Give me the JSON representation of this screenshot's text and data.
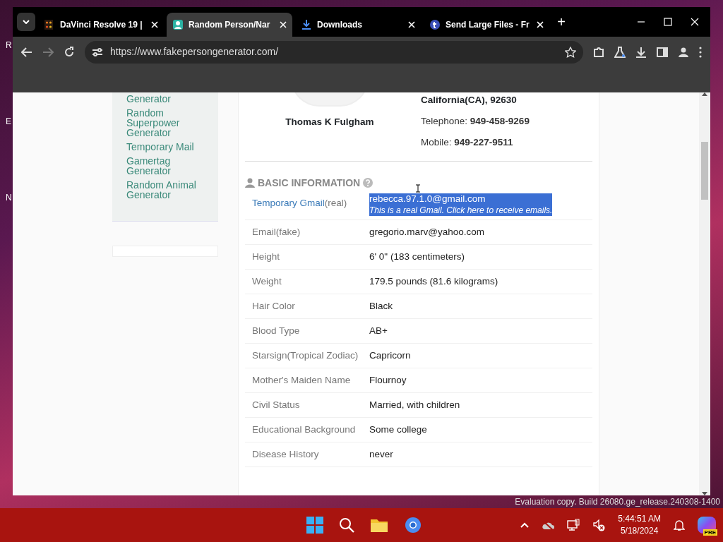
{
  "desktop": {
    "icon_labels": [
      "R",
      "E",
      "N"
    ],
    "watermark": "Evaluation copy. Build 26080.ge_release.240308-1400"
  },
  "browser": {
    "tabs": [
      {
        "title": "DaVinci Resolve 19 |",
        "selected": false
      },
      {
        "title": "Random Person/Nar",
        "selected": true
      },
      {
        "title": "Downloads",
        "selected": false
      },
      {
        "title": "Send Large Files - Fr",
        "selected": false
      }
    ],
    "new_tab": "+",
    "address": "https://www.fakepersongenerator.com/"
  },
  "sidebar": {
    "links": [
      "Generator",
      "Random Superpower Generator",
      "Temporary Mail",
      "Gamertag Generator",
      "Random Animal Generator"
    ]
  },
  "profile": {
    "name": "Thomas K Fulgham",
    "address": "California(CA), 92630",
    "contacts": [
      {
        "label": "Telephone:",
        "value": "949-458-9269"
      },
      {
        "label": "Mobile:",
        "value": "949-227-9511"
      }
    ]
  },
  "section_title": "BASIC INFORMATION",
  "rows": [
    {
      "label": "Temporary Gmail",
      "label_suffix": "(real)",
      "value": "rebecca.97.1.0@gmail.com",
      "note": "This is a real Gmail. Click here to receive emails.",
      "selected": true
    },
    {
      "label": "Email(fake)",
      "value": "gregorio.marv@yahoo.com",
      "selected": false
    },
    {
      "label": "Height",
      "value": "6' 0\" (183 centimeters)",
      "selected": false
    },
    {
      "label": "Weight",
      "value": "179.5 pounds (81.6 kilograms)",
      "selected": false
    },
    {
      "label": "Hair Color",
      "value": "Black",
      "selected": false
    },
    {
      "label": "Blood Type",
      "value": "AB+",
      "selected": false
    },
    {
      "label": "Starsign(Tropical Zodiac)",
      "value": "Capricorn",
      "selected": false
    },
    {
      "label": "Mother's Maiden Name",
      "value": "Flournoy",
      "selected": false
    },
    {
      "label": "Civil Status",
      "value": "Married, with children",
      "selected": false
    },
    {
      "label": "Educational Background",
      "value": "Some college",
      "selected": false
    },
    {
      "label": "Disease History",
      "value": "never",
      "selected": false
    }
  ],
  "taskbar": {
    "time": "5:44:51 AM",
    "date": "5/18/2024",
    "copilot_badge": "PRE"
  }
}
